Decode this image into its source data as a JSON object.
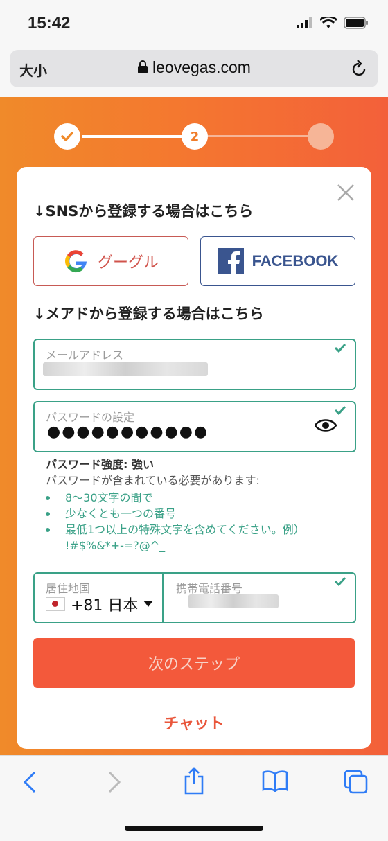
{
  "status": {
    "time": "15:42"
  },
  "browser": {
    "text_size": "大小",
    "url": "leovegas.com"
  },
  "stepper": {
    "current_step": "2"
  },
  "form": {
    "sns_title": "↓SNSから登録する場合はこちら",
    "google_label": "グーグル",
    "facebook_label": "FACEBOOK",
    "email_title": "↓メアドから登録する場合はこちら",
    "email_label": "メールアドレス",
    "password_label": "パスワードの設定",
    "password_value": "●●●●●●●●●●●",
    "strength_prefix": "パスワード強度: ",
    "strength_value": "強い",
    "requirements_title": "パスワードが含まれている必要があります:",
    "requirements": [
      "8〜30文字の間で",
      "少なくとも一つの番号",
      "最低1つ以上の特殊文字を含めてください。例）"
    ],
    "special_chars": "!#$%&*+-=?@^_",
    "country_label": "居住地国",
    "country_value": "+81 日本",
    "phone_label": "携帯電話番号",
    "next_button": "次のステップ",
    "chat_link": "チャット"
  },
  "colors": {
    "accent_orange": "#f3593b",
    "valid_green": "#3aa187",
    "facebook_blue": "#3a558f"
  },
  "icons": [
    "signal-icon",
    "wifi-icon",
    "battery-icon",
    "lock-icon",
    "reload-icon",
    "check-icon",
    "close-icon",
    "google-icon",
    "facebook-icon",
    "eye-icon",
    "back-icon",
    "forward-icon",
    "share-icon",
    "bookmarks-icon",
    "tabs-icon"
  ]
}
